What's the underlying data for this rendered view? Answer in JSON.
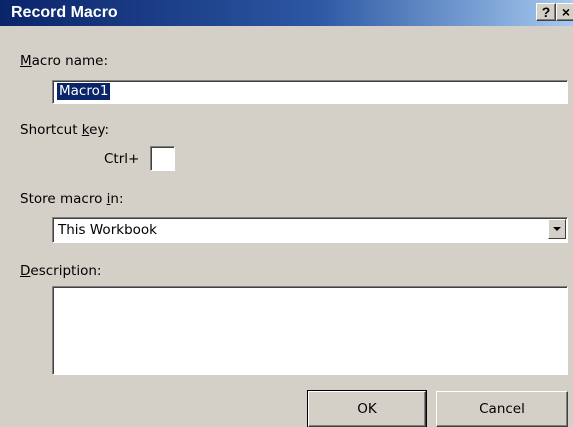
{
  "window": {
    "title": "Record Macro",
    "help_label": "?",
    "close_label": "×"
  },
  "form": {
    "macro_name_label": "Macro name:",
    "macro_name_value": "Macro1",
    "shortcut_key_label": "Shortcut key:",
    "shortcut_prefix": "Ctrl+",
    "shortcut_value": "",
    "store_macro_label": "Store macro in:",
    "store_macro_value": "This Workbook",
    "description_label": "Description:",
    "description_value": ""
  },
  "buttons": {
    "ok": "OK",
    "cancel": "Cancel"
  },
  "icons": {
    "dropdown": "chevron-down-icon",
    "close": "close-icon",
    "help": "help-icon"
  },
  "colors": {
    "title_bar_start": "#0a246a",
    "title_bar_end": "#a6caf0",
    "dialog_face": "#d4d0c8",
    "selection_highlight": "#0a246a"
  }
}
